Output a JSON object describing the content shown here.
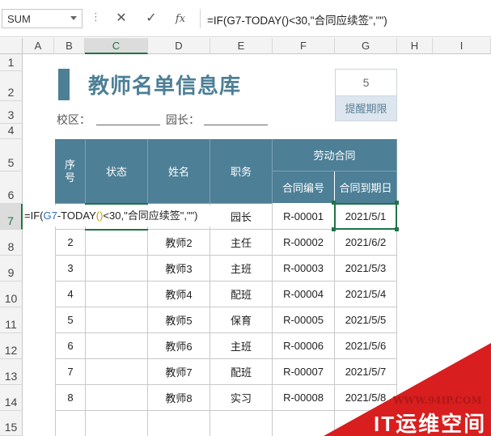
{
  "formula_bar": {
    "name_box": "SUM",
    "cancel_icon": "close-icon",
    "enter_icon": "check-icon",
    "fx_label": "fx",
    "formula": "=IF(G7-TODAY()<30,\"合同应续签\",\"\")"
  },
  "columns": [
    "A",
    "B",
    "C",
    "D",
    "E",
    "F",
    "G",
    "H",
    "I"
  ],
  "rows": [
    "1",
    "2",
    "3",
    "4",
    "5",
    "6",
    "7",
    "8",
    "9",
    "10",
    "11",
    "12",
    "13",
    "14",
    "15"
  ],
  "sheet": {
    "title": "教师名单信息库",
    "reminder_value": "5",
    "reminder_label": "提醒期限",
    "school_label": "校区：",
    "head_label": "园长：",
    "headers": {
      "seq": "序号",
      "status": "状态",
      "name": "姓名",
      "role": "职务",
      "contract": "劳动合同",
      "contract_no": "合同编号",
      "contract_due": "合同到期日"
    },
    "editing_formula": {
      "prefix": "=IF(",
      "ref": "G7",
      "mid": "-TODAY",
      "paren": "()",
      "suffix": "<30,\"合同应续签\",\"\")"
    },
    "rows": [
      {
        "seq": "",
        "name": "",
        "role": "园长",
        "no": "R-00001",
        "due": "2021/5/1"
      },
      {
        "seq": "2",
        "name": "教师2",
        "role": "主任",
        "no": "R-00002",
        "due": "2021/6/2"
      },
      {
        "seq": "3",
        "name": "教师3",
        "role": "主班",
        "no": "R-00003",
        "due": "2021/5/3"
      },
      {
        "seq": "4",
        "name": "教师4",
        "role": "配班",
        "no": "R-00004",
        "due": "2021/5/4"
      },
      {
        "seq": "5",
        "name": "教师5",
        "role": "保育",
        "no": "R-00005",
        "due": "2021/5/5"
      },
      {
        "seq": "6",
        "name": "教师6",
        "role": "主班",
        "no": "R-00006",
        "due": "2021/5/6"
      },
      {
        "seq": "7",
        "name": "教师7",
        "role": "配班",
        "no": "R-00007",
        "due": "2021/5/7"
      },
      {
        "seq": "8",
        "name": "教师8",
        "role": "实习",
        "no": "R-00008",
        "due": "2021/5/8"
      }
    ]
  },
  "watermark": {
    "url": "WWW.94IP.COM",
    "text": "IT运维空间"
  },
  "colors": {
    "header_fill": "#4d7f96",
    "accent_green": "#217346",
    "watermark_red": "#d81e1e"
  }
}
